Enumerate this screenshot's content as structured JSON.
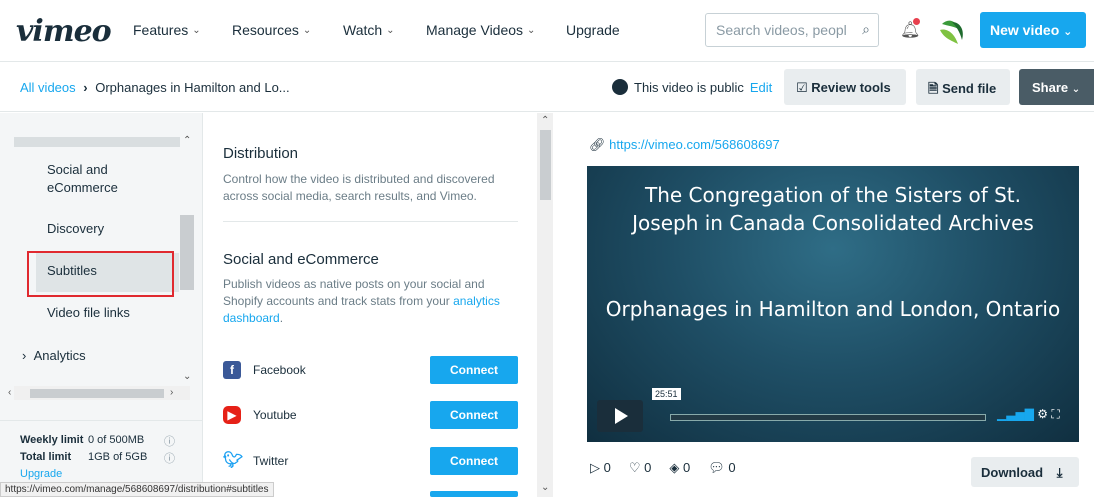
{
  "header": {
    "logo": "vimeo",
    "nav": [
      "Features",
      "Resources",
      "Watch",
      "Manage Videos",
      "Upgrade"
    ],
    "search_placeholder": "Search videos, peopl",
    "new_video": "New video"
  },
  "subbar": {
    "breadcrumb_root": "All videos",
    "breadcrumb_current": "Orphanages in Hamilton and Lo...",
    "privacy": "This video is public",
    "edit": "Edit",
    "review_tools": "Review tools",
    "send_file": "Send file",
    "share": "Share"
  },
  "sidebar": {
    "items": [
      "Social and eCommerce",
      "Discovery",
      "Subtitles",
      "Video file links",
      "Analytics"
    ],
    "selected": "Subtitles",
    "weekly_limit_label": "Weekly limit",
    "weekly_limit_value": "0 of 500MB",
    "total_limit_label": "Total limit",
    "total_limit_value": "1GB of 5GB",
    "upgrade": "Upgrade"
  },
  "distribution": {
    "title": "Distribution",
    "desc": "Control how the video is distributed and discovered across social media, search results, and Vimeo.",
    "social_title": "Social and eCommerce",
    "social_desc": "Publish videos as native posts on your social and Shopify accounts and track stats from your",
    "social_link": "analytics dashboard",
    "platforms": [
      {
        "name": "Facebook",
        "button": "Connect"
      },
      {
        "name": "Youtube",
        "button": "Connect"
      },
      {
        "name": "Twitter",
        "button": "Connect"
      }
    ]
  },
  "video": {
    "url": "https://vimeo.com/568608697",
    "title_line1": "The Congregation of the Sisters of St.",
    "title_line2": "Joseph in Canada Consolidated Archives",
    "title_line3": "Orphanages in Hamilton and London, Ontario",
    "duration": "25:51",
    "plays": "0",
    "likes": "0",
    "collections": "0",
    "comments": "0",
    "download": "Download"
  },
  "statusbar": "https://vimeo.com/manage/568608697/distribution#subtitles"
}
